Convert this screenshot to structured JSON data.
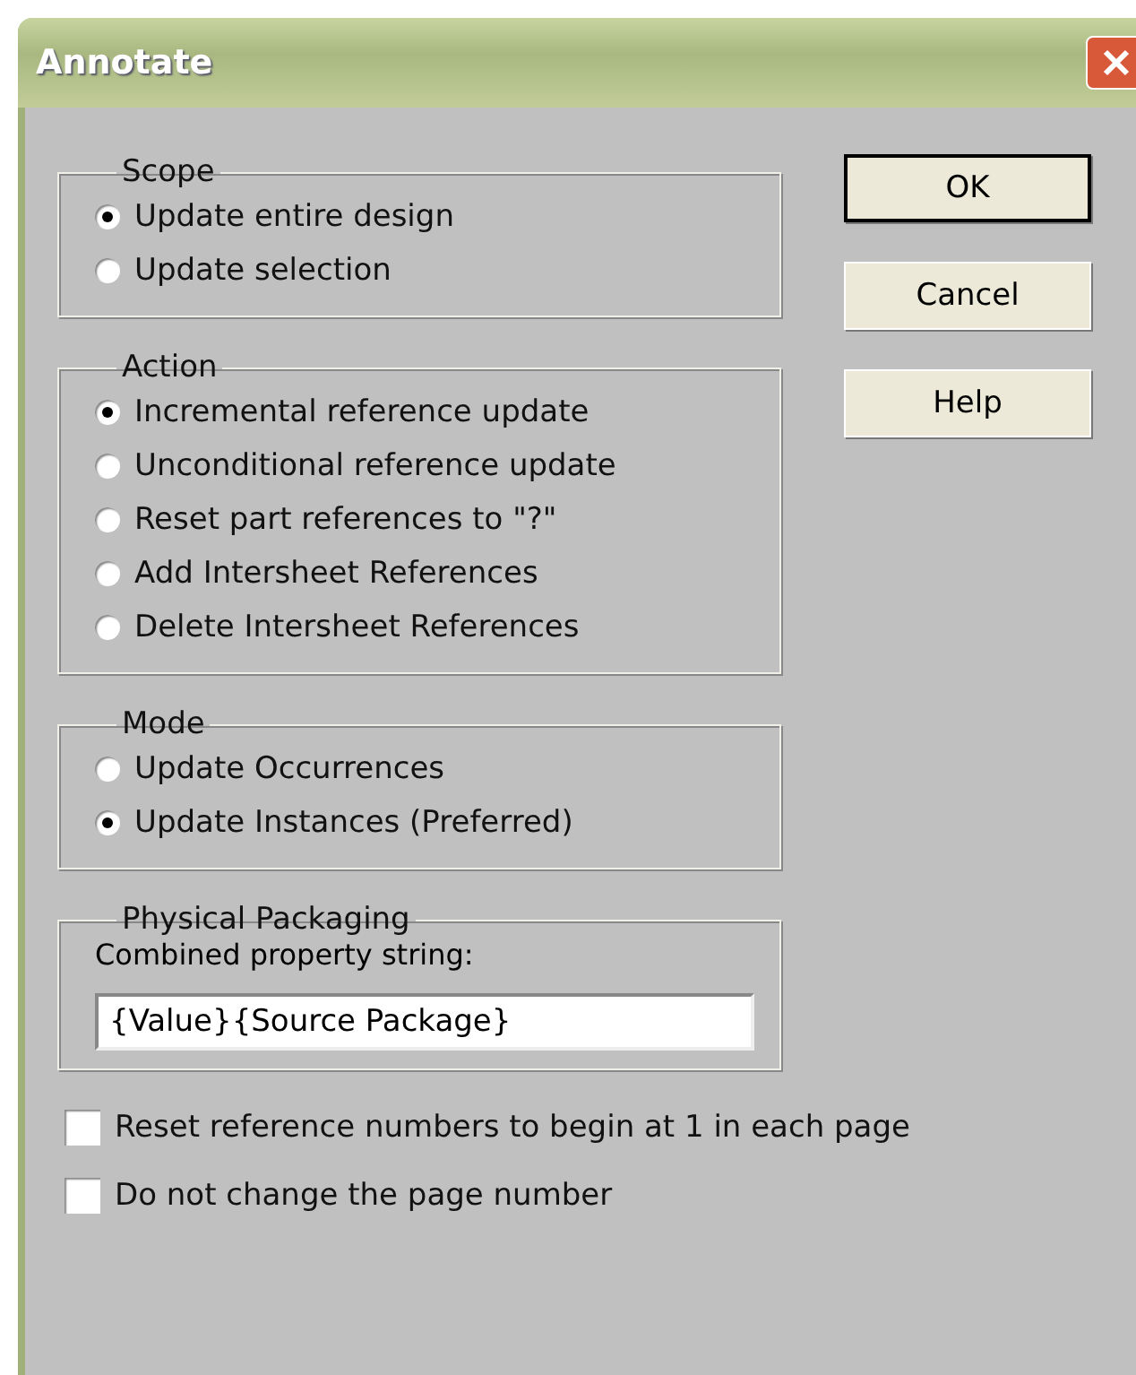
{
  "window": {
    "title": "Annotate"
  },
  "groups": [
    {
      "title": "Scope",
      "kind": "radio",
      "options": [
        {
          "label": "Update entire design",
          "selected": true
        },
        {
          "label": "Update selection",
          "selected": false
        }
      ]
    },
    {
      "title": "Action",
      "kind": "radio",
      "options": [
        {
          "label": "Incremental reference update",
          "selected": true
        },
        {
          "label": "Unconditional reference update",
          "selected": false
        },
        {
          "label": "Reset part references to \"?\"",
          "selected": false
        },
        {
          "label": "Add Intersheet References",
          "selected": false
        },
        {
          "label": "Delete Intersheet References",
          "selected": false
        }
      ]
    },
    {
      "title": "Mode",
      "kind": "radio",
      "options": [
        {
          "label": "Update Occurrences",
          "selected": false
        },
        {
          "label": "Update Instances (Preferred)",
          "selected": true
        }
      ]
    },
    {
      "title": "Physical Packaging",
      "kind": "field",
      "label": "Combined property string:",
      "value": "{Value}{Source Package}"
    }
  ],
  "checkboxes": [
    {
      "label": "Reset reference numbers to begin at 1 in each page",
      "checked": false
    },
    {
      "label": "Do not change the page number",
      "checked": false
    }
  ],
  "buttons": [
    {
      "label": "OK",
      "default": true
    },
    {
      "label": "Cancel",
      "default": false
    },
    {
      "label": "Help",
      "default": false
    }
  ]
}
